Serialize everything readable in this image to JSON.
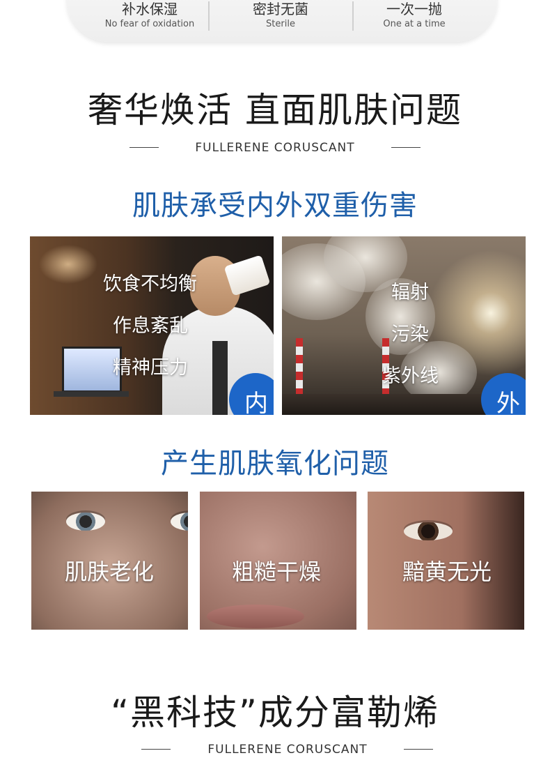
{
  "features": [
    {
      "cn": "补水保湿",
      "en": "No fear of oxidation"
    },
    {
      "cn": "密封无菌",
      "en": "Sterile"
    },
    {
      "cn": "一次一抛",
      "en": "One at a time"
    }
  ],
  "section1": {
    "title": "奢华焕活 直面肌肤问题",
    "subtitle_en": "FULLERENE CORUSCANT"
  },
  "damage": {
    "title": "肌肤承受内外双重伤害",
    "inner": {
      "items": [
        "饮食不均衡",
        "作息紊乱",
        "精神压力"
      ],
      "badge": "内"
    },
    "outer": {
      "items": [
        "辐射",
        "污染",
        "紫外线"
      ],
      "badge": "外"
    }
  },
  "problems": {
    "title": "产生肌肤氧化问题",
    "items": [
      "肌肤老化",
      "粗糙干燥",
      "黯黄无光"
    ]
  },
  "section2": {
    "title": "“黑科技”成分富勒烯",
    "subtitle_en": "FULLERENE CORUSCANT"
  },
  "colors": {
    "accent_blue": "#1f5fa9",
    "badge_blue": "#1d66c8"
  }
}
